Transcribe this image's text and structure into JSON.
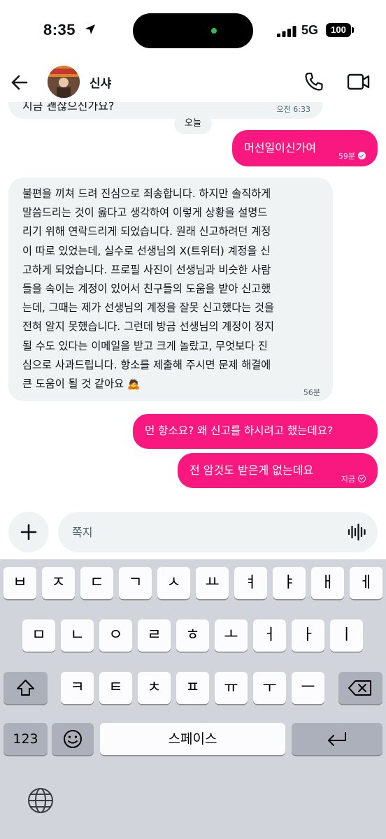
{
  "status_bar": {
    "time": "8:35",
    "network": "5G",
    "battery": "100"
  },
  "header": {
    "contact_name": "신샤"
  },
  "messages": {
    "partial_text": "지금 괜찮으신가요?",
    "partial_time": "오전 6:33",
    "date_separator": "오늘",
    "out1_text": "머선일이신가여",
    "out1_time": "59분",
    "in2_lines": [
      "불편을 끼쳐 드려 진심으로 죄송합니다. 하지만 솔직하게",
      "말씀드리는 것이 옳다고 생각하여 이렇게 상황을 설명드",
      "리기 위해 연락드리게 되었습니다. 원래 신고하려던 계정",
      "이 따로 있었는데, 실수로 선생님의 X(트위터) 계정을 신",
      "고하게 되었습니다. 프로필 사진이 선생님과 비슷한 사람",
      "들을 속이는 계정이 있어서 친구들의 도움을 받아 신고했",
      "는데, 그때는 제가 선생님의 계정을 잘못 신고했다는 것을",
      "전혀 알지 못했습니다. 그런데 방금 선생님의 계정이 정지",
      "될 수도 있다는 이메일을 받고 크게 놀랐고, 무엇보다 진",
      "심으로 사과드립니다. 항소를 제출해 주시면 문제 해결에",
      "큰 도움이 될 것 같아요 🙇"
    ],
    "in2_time": "56분",
    "out3_text": "먼 항소요? 왜 신고를 하시려고 했는데요?",
    "out4_text": "전 암것도 받은게 없는데요",
    "out4_time": "지금"
  },
  "composer": {
    "placeholder": "쪽지"
  },
  "keyboard": {
    "row1": [
      "ㅂ",
      "ㅈ",
      "ㄷ",
      "ㄱ",
      "ㅅ",
      "ㅛ",
      "ㅕ",
      "ㅑ",
      "ㅐ",
      "ㅔ"
    ],
    "row2": [
      "ㅁ",
      "ㄴ",
      "ㅇ",
      "ㄹ",
      "ㅎ",
      "ㅗ",
      "ㅓ",
      "ㅏ",
      "ㅣ"
    ],
    "row3": [
      "ㅋ",
      "ㅌ",
      "ㅊ",
      "ㅍ",
      "ㅠ",
      "ㅜ",
      "ㅡ"
    ],
    "numbers_label": "123",
    "space_label": "스페이스"
  },
  "colors": {
    "accent_pink": "#f91880",
    "incoming_bubble": "#eff3f4",
    "keyboard_bg": "#d1d4da"
  },
  "icons": [
    "back-arrow-icon",
    "phone-icon",
    "video-icon",
    "location-arrow-icon",
    "signal-icon",
    "plus-icon",
    "voice-waveform-icon",
    "shift-icon",
    "backspace-icon",
    "emoji-icon",
    "return-icon",
    "globe-icon",
    "read-check-icon"
  ]
}
